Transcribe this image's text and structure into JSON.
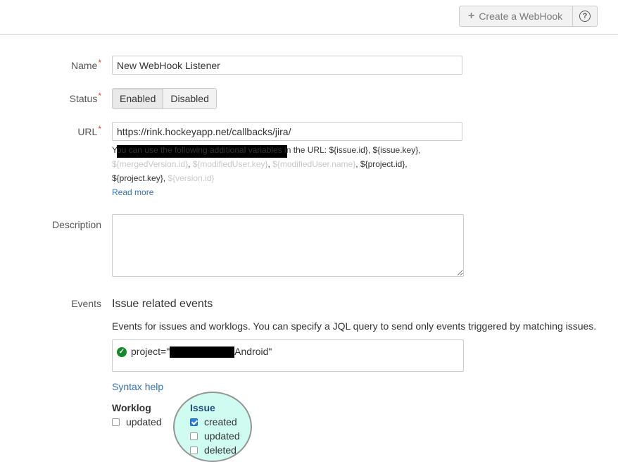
{
  "header": {
    "create_button_label": "Create a WebHook",
    "plus_icon": "+",
    "help_icon": "?"
  },
  "form": {
    "name": {
      "label": "Name",
      "required_mark": "*",
      "value": "New WebHook Listener"
    },
    "status": {
      "label": "Status",
      "required_mark": "*",
      "options": [
        "Enabled",
        "Disabled"
      ],
      "selected": "Enabled"
    },
    "url": {
      "label": "URL",
      "required_mark": "*",
      "value": "https://rink.hockeyapp.net/callbacks/jira/",
      "hint_intro": "You can use the following additional variables in the URL:",
      "variables": [
        {
          "text": "${issue.id}",
          "dim": false
        },
        {
          "text": "${issue.key}",
          "dim": false
        },
        {
          "text": "${mergedVersion.id}",
          "dim": true
        },
        {
          "text": "${modifiedUser.key}",
          "dim": true
        },
        {
          "text": "${modifiedUser.name}",
          "dim": true
        },
        {
          "text": "${project.id}",
          "dim": false
        },
        {
          "text": "${project.key}",
          "dim": false
        },
        {
          "text": "${version.id}",
          "dim": true
        }
      ],
      "read_more": "Read more"
    },
    "description": {
      "label": "Description",
      "value": ""
    },
    "events": {
      "label": "Events",
      "section_title": "Issue related events",
      "section_desc": "Events for issues and worklogs. You can specify a JQL query to send only events triggered by matching issues.",
      "jql_prefix": "project=\"",
      "jql_suffix": "Android\"",
      "syntax_help": "Syntax help",
      "worklog": {
        "title": "Worklog",
        "items": [
          {
            "label": "updated",
            "checked": false
          }
        ]
      },
      "issue": {
        "title": "Issue",
        "items": [
          {
            "label": "created",
            "checked": true
          },
          {
            "label": "updated",
            "checked": false
          },
          {
            "label": "deleted",
            "checked": false
          }
        ]
      }
    }
  },
  "colors": {
    "link": "#3572b0",
    "required": "#d04437",
    "valid": "#14892c",
    "highlight": "#ccfbef",
    "issue_title": "#205081"
  }
}
